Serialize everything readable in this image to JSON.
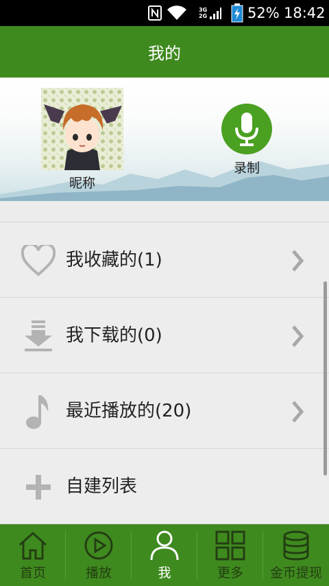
{
  "status_bar": {
    "network_top": "3G",
    "network_bottom": "2G",
    "battery_percent": "52%",
    "time": "18:42"
  },
  "header": {
    "title": "我的"
  },
  "profile": {
    "nickname": "昵称",
    "record_label": "录制"
  },
  "list": {
    "items": [
      {
        "label": "我收藏的(1)",
        "icon": "heart-icon"
      },
      {
        "label": "我下载的(0)",
        "icon": "download-icon"
      },
      {
        "label": "最近播放的(20)",
        "icon": "music-note-icon"
      },
      {
        "label": "自建列表",
        "icon": "plus-icon"
      }
    ]
  },
  "bottom_nav": {
    "items": [
      {
        "label": "首页",
        "icon": "home-icon"
      },
      {
        "label": "播放",
        "icon": "play-icon"
      },
      {
        "label": "我",
        "icon": "user-icon",
        "active": true
      },
      {
        "label": "更多",
        "icon": "grid-icon"
      },
      {
        "label": "金币提现",
        "icon": "coins-icon"
      }
    ]
  },
  "colors": {
    "primary": "#3f8a1f",
    "record_button": "#4aa021",
    "nav_active_text": "#ffffff",
    "nav_inactive_text": "#233f12"
  }
}
